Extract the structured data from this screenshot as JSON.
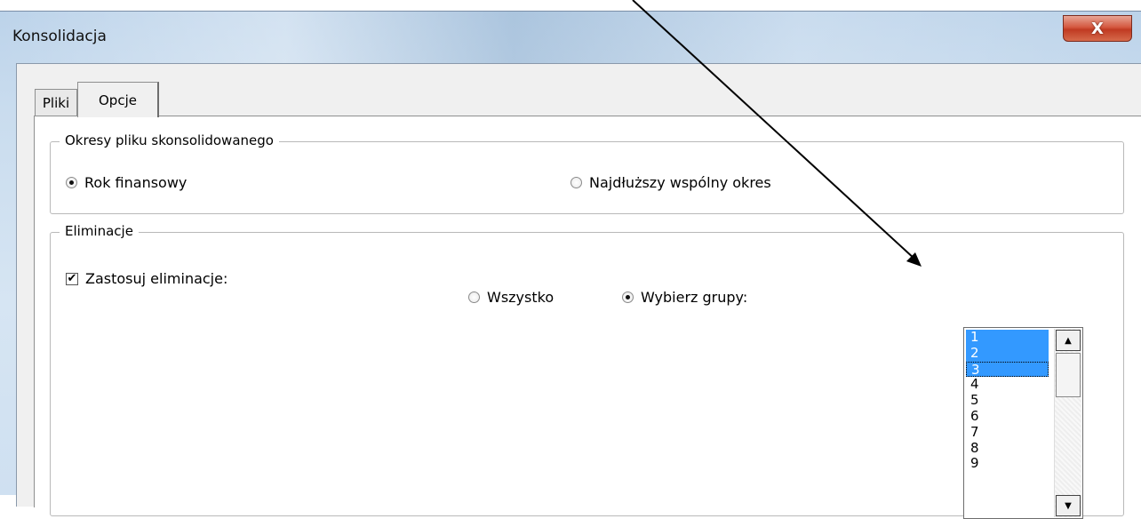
{
  "window": {
    "title": "Konsolidacja",
    "close_glyph": "X"
  },
  "tabs": [
    {
      "label": "Pliki",
      "active": false
    },
    {
      "label": "Opcje",
      "active": true
    }
  ],
  "periods_group": {
    "legend": "Okresy pliku skonsolidowanego",
    "options": [
      {
        "label": "Rok finansowy",
        "checked": true
      },
      {
        "label": "Najdłuższy wspólny okres",
        "checked": false
      }
    ]
  },
  "eliminations_group": {
    "legend": "Eliminacje",
    "apply_checkbox": {
      "label": "Zastosuj eliminacje:",
      "checked": true,
      "glyph": "✔"
    },
    "options": [
      {
        "label": "Wszystko",
        "checked": false
      },
      {
        "label": "Wybierz grupy:",
        "checked": true
      }
    ],
    "groups_list": {
      "items": [
        "1",
        "2",
        "3",
        "4",
        "5",
        "6",
        "7",
        "8",
        "9"
      ],
      "selected": [
        "1",
        "2",
        "3"
      ],
      "focused": "3",
      "scroll_up_glyph": "▲",
      "scroll_down_glyph": "▼"
    }
  },
  "colors": {
    "selection": "#3399ff",
    "close_button": "#c03a22"
  }
}
